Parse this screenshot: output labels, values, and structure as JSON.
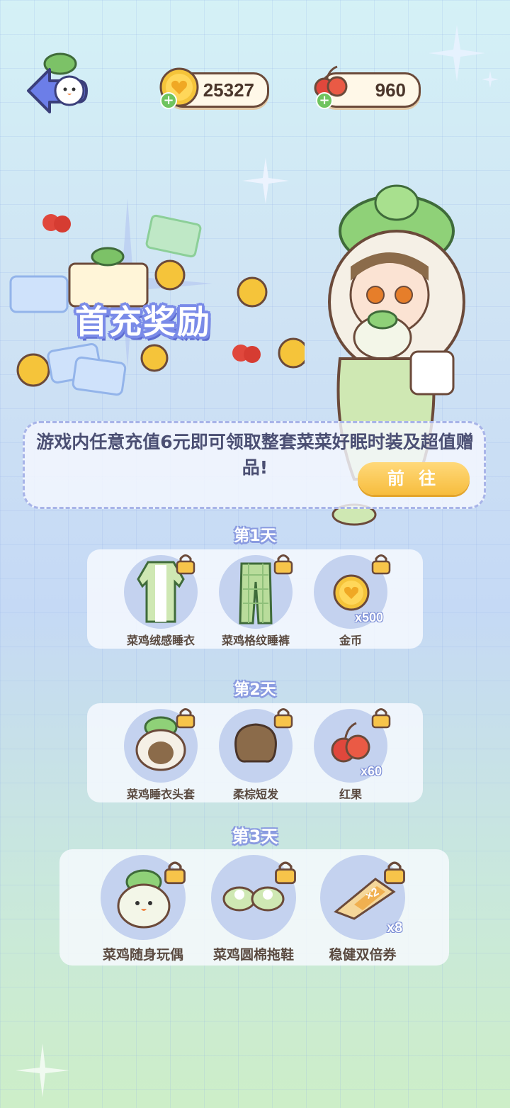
{
  "header": {
    "coins": "25327",
    "fruits": "960"
  },
  "banner": {
    "title": "首充奖励",
    "description": "游戏内任意充值6元即可领取整套菜菜好眠时装及超值赠品!",
    "go_button": "前 往"
  },
  "days": [
    {
      "label": "第1天",
      "items": [
        {
          "name": "菜鸡绒感睡衣",
          "qty": ""
        },
        {
          "name": "菜鸡格纹睡裤",
          "qty": ""
        },
        {
          "name": "金币",
          "qty": "x500"
        }
      ]
    },
    {
      "label": "第2天",
      "items": [
        {
          "name": "菜鸡睡衣头套",
          "qty": ""
        },
        {
          "name": "柔棕短发",
          "qty": ""
        },
        {
          "name": "红果",
          "qty": "x60"
        }
      ]
    },
    {
      "label": "第3天",
      "items": [
        {
          "name": "菜鸡随身玩偶",
          "qty": ""
        },
        {
          "name": "菜鸡圆棉拖鞋",
          "qty": ""
        },
        {
          "name": "稳健双倍券",
          "qty": "x8"
        }
      ]
    }
  ],
  "colors": {
    "accent_purple": "#7a8be8",
    "button_yellow": "#f7bd3e",
    "item_circle": "#c4d2ef"
  }
}
